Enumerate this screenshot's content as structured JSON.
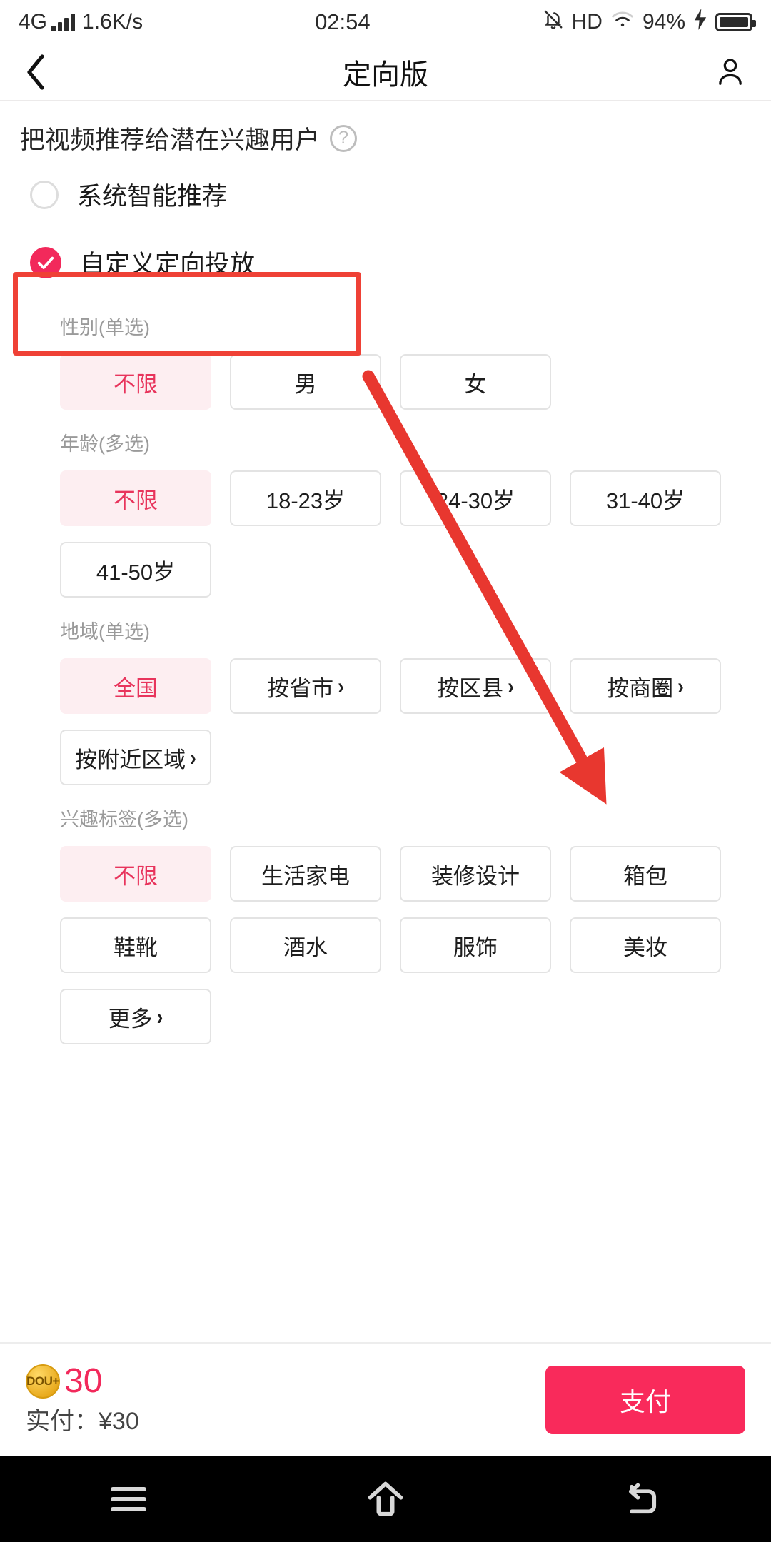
{
  "status_bar": {
    "network": "4G",
    "speed": "1.6K/s",
    "time": "02:54",
    "hd": "HD",
    "battery_percent": "94%",
    "icons": [
      "signal-bars-icon",
      "bell-off-icon",
      "hd-icon",
      "wifi-icon",
      "charging-bolt-icon",
      "battery-icon"
    ]
  },
  "header": {
    "back_icon": "chevron-left-icon",
    "title": "定向版",
    "account_icon": "person-icon"
  },
  "promo": {
    "text": "把视频推荐给潜在兴趣用户",
    "help_icon": "question-mark-icon",
    "help_glyph": "?"
  },
  "radio_options": [
    {
      "label": "系统智能推荐",
      "selected": false
    },
    {
      "label": "自定义定向投放",
      "selected": true
    }
  ],
  "groups": [
    {
      "title": "性别(单选)",
      "options": [
        {
          "label": "不限",
          "selected": true,
          "caret": false
        },
        {
          "label": "男",
          "selected": false,
          "caret": false
        },
        {
          "label": "女",
          "selected": false,
          "caret": false
        }
      ]
    },
    {
      "title": "年龄(多选)",
      "options": [
        {
          "label": "不限",
          "selected": true,
          "caret": false
        },
        {
          "label": "18-23岁",
          "selected": false,
          "caret": false
        },
        {
          "label": "24-30岁",
          "selected": false,
          "caret": false
        },
        {
          "label": "31-40岁",
          "selected": false,
          "caret": false
        },
        {
          "label": "41-50岁",
          "selected": false,
          "caret": false
        }
      ]
    },
    {
      "title": "地域(单选)",
      "options": [
        {
          "label": "全国",
          "selected": true,
          "caret": false
        },
        {
          "label": "按省市",
          "selected": false,
          "caret": true
        },
        {
          "label": "按区县",
          "selected": false,
          "caret": true
        },
        {
          "label": "按商圈",
          "selected": false,
          "caret": true
        },
        {
          "label": "按附近区域",
          "selected": false,
          "caret": true
        }
      ]
    },
    {
      "title": "兴趣标签(多选)",
      "options": [
        {
          "label": "不限",
          "selected": true,
          "caret": false
        },
        {
          "label": "生活家电",
          "selected": false,
          "caret": false
        },
        {
          "label": "装修设计",
          "selected": false,
          "caret": false
        },
        {
          "label": "箱包",
          "selected": false,
          "caret": false
        },
        {
          "label": "鞋靴",
          "selected": false,
          "caret": false
        },
        {
          "label": "酒水",
          "selected": false,
          "caret": false
        },
        {
          "label": "服饰",
          "selected": false,
          "caret": false
        },
        {
          "label": "美妆",
          "selected": false,
          "caret": false
        },
        {
          "label": "更多",
          "selected": false,
          "caret": true
        }
      ]
    }
  ],
  "bottom_bar": {
    "coin_icon": "dou-plus-coin-icon",
    "coin_label": "DOU+",
    "coin_amount": "30",
    "actual_pay": "实付：¥30",
    "pay_button": "支付"
  },
  "android_nav": {
    "menu_icon": "menu-icon",
    "home_icon": "home-icon",
    "back_icon": "back-icon"
  },
  "annotations": {
    "highlight_color": "#ef4136",
    "arrow_color": "#e8372f",
    "highlight_target": "自定义定向投放",
    "arrow_target": "按区县"
  },
  "colors": {
    "accent": "#f2295b",
    "chip_selected_bg": "#fdeef1",
    "chip_selected_text": "#e8345c",
    "pay_button": "#f92a5b"
  }
}
